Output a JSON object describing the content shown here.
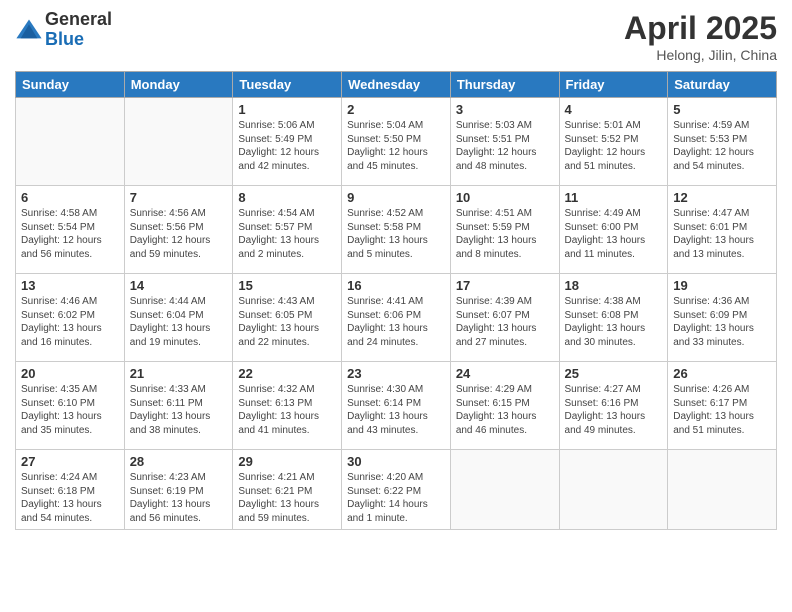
{
  "logo": {
    "general": "General",
    "blue": "Blue"
  },
  "header": {
    "month": "April 2025",
    "location": "Helong, Jilin, China"
  },
  "weekdays": [
    "Sunday",
    "Monday",
    "Tuesday",
    "Wednesday",
    "Thursday",
    "Friday",
    "Saturday"
  ],
  "weeks": [
    [
      {
        "day": "",
        "info": ""
      },
      {
        "day": "",
        "info": ""
      },
      {
        "day": "1",
        "info": "Sunrise: 5:06 AM\nSunset: 5:49 PM\nDaylight: 12 hours and 42 minutes."
      },
      {
        "day": "2",
        "info": "Sunrise: 5:04 AM\nSunset: 5:50 PM\nDaylight: 12 hours and 45 minutes."
      },
      {
        "day": "3",
        "info": "Sunrise: 5:03 AM\nSunset: 5:51 PM\nDaylight: 12 hours and 48 minutes."
      },
      {
        "day": "4",
        "info": "Sunrise: 5:01 AM\nSunset: 5:52 PM\nDaylight: 12 hours and 51 minutes."
      },
      {
        "day": "5",
        "info": "Sunrise: 4:59 AM\nSunset: 5:53 PM\nDaylight: 12 hours and 54 minutes."
      }
    ],
    [
      {
        "day": "6",
        "info": "Sunrise: 4:58 AM\nSunset: 5:54 PM\nDaylight: 12 hours and 56 minutes."
      },
      {
        "day": "7",
        "info": "Sunrise: 4:56 AM\nSunset: 5:56 PM\nDaylight: 12 hours and 59 minutes."
      },
      {
        "day": "8",
        "info": "Sunrise: 4:54 AM\nSunset: 5:57 PM\nDaylight: 13 hours and 2 minutes."
      },
      {
        "day": "9",
        "info": "Sunrise: 4:52 AM\nSunset: 5:58 PM\nDaylight: 13 hours and 5 minutes."
      },
      {
        "day": "10",
        "info": "Sunrise: 4:51 AM\nSunset: 5:59 PM\nDaylight: 13 hours and 8 minutes."
      },
      {
        "day": "11",
        "info": "Sunrise: 4:49 AM\nSunset: 6:00 PM\nDaylight: 13 hours and 11 minutes."
      },
      {
        "day": "12",
        "info": "Sunrise: 4:47 AM\nSunset: 6:01 PM\nDaylight: 13 hours and 13 minutes."
      }
    ],
    [
      {
        "day": "13",
        "info": "Sunrise: 4:46 AM\nSunset: 6:02 PM\nDaylight: 13 hours and 16 minutes."
      },
      {
        "day": "14",
        "info": "Sunrise: 4:44 AM\nSunset: 6:04 PM\nDaylight: 13 hours and 19 minutes."
      },
      {
        "day": "15",
        "info": "Sunrise: 4:43 AM\nSunset: 6:05 PM\nDaylight: 13 hours and 22 minutes."
      },
      {
        "day": "16",
        "info": "Sunrise: 4:41 AM\nSunset: 6:06 PM\nDaylight: 13 hours and 24 minutes."
      },
      {
        "day": "17",
        "info": "Sunrise: 4:39 AM\nSunset: 6:07 PM\nDaylight: 13 hours and 27 minutes."
      },
      {
        "day": "18",
        "info": "Sunrise: 4:38 AM\nSunset: 6:08 PM\nDaylight: 13 hours and 30 minutes."
      },
      {
        "day": "19",
        "info": "Sunrise: 4:36 AM\nSunset: 6:09 PM\nDaylight: 13 hours and 33 minutes."
      }
    ],
    [
      {
        "day": "20",
        "info": "Sunrise: 4:35 AM\nSunset: 6:10 PM\nDaylight: 13 hours and 35 minutes."
      },
      {
        "day": "21",
        "info": "Sunrise: 4:33 AM\nSunset: 6:11 PM\nDaylight: 13 hours and 38 minutes."
      },
      {
        "day": "22",
        "info": "Sunrise: 4:32 AM\nSunset: 6:13 PM\nDaylight: 13 hours and 41 minutes."
      },
      {
        "day": "23",
        "info": "Sunrise: 4:30 AM\nSunset: 6:14 PM\nDaylight: 13 hours and 43 minutes."
      },
      {
        "day": "24",
        "info": "Sunrise: 4:29 AM\nSunset: 6:15 PM\nDaylight: 13 hours and 46 minutes."
      },
      {
        "day": "25",
        "info": "Sunrise: 4:27 AM\nSunset: 6:16 PM\nDaylight: 13 hours and 49 minutes."
      },
      {
        "day": "26",
        "info": "Sunrise: 4:26 AM\nSunset: 6:17 PM\nDaylight: 13 hours and 51 minutes."
      }
    ],
    [
      {
        "day": "27",
        "info": "Sunrise: 4:24 AM\nSunset: 6:18 PM\nDaylight: 13 hours and 54 minutes."
      },
      {
        "day": "28",
        "info": "Sunrise: 4:23 AM\nSunset: 6:19 PM\nDaylight: 13 hours and 56 minutes."
      },
      {
        "day": "29",
        "info": "Sunrise: 4:21 AM\nSunset: 6:21 PM\nDaylight: 13 hours and 59 minutes."
      },
      {
        "day": "30",
        "info": "Sunrise: 4:20 AM\nSunset: 6:22 PM\nDaylight: 14 hours and 1 minute."
      },
      {
        "day": "",
        "info": ""
      },
      {
        "day": "",
        "info": ""
      },
      {
        "day": "",
        "info": ""
      }
    ]
  ]
}
